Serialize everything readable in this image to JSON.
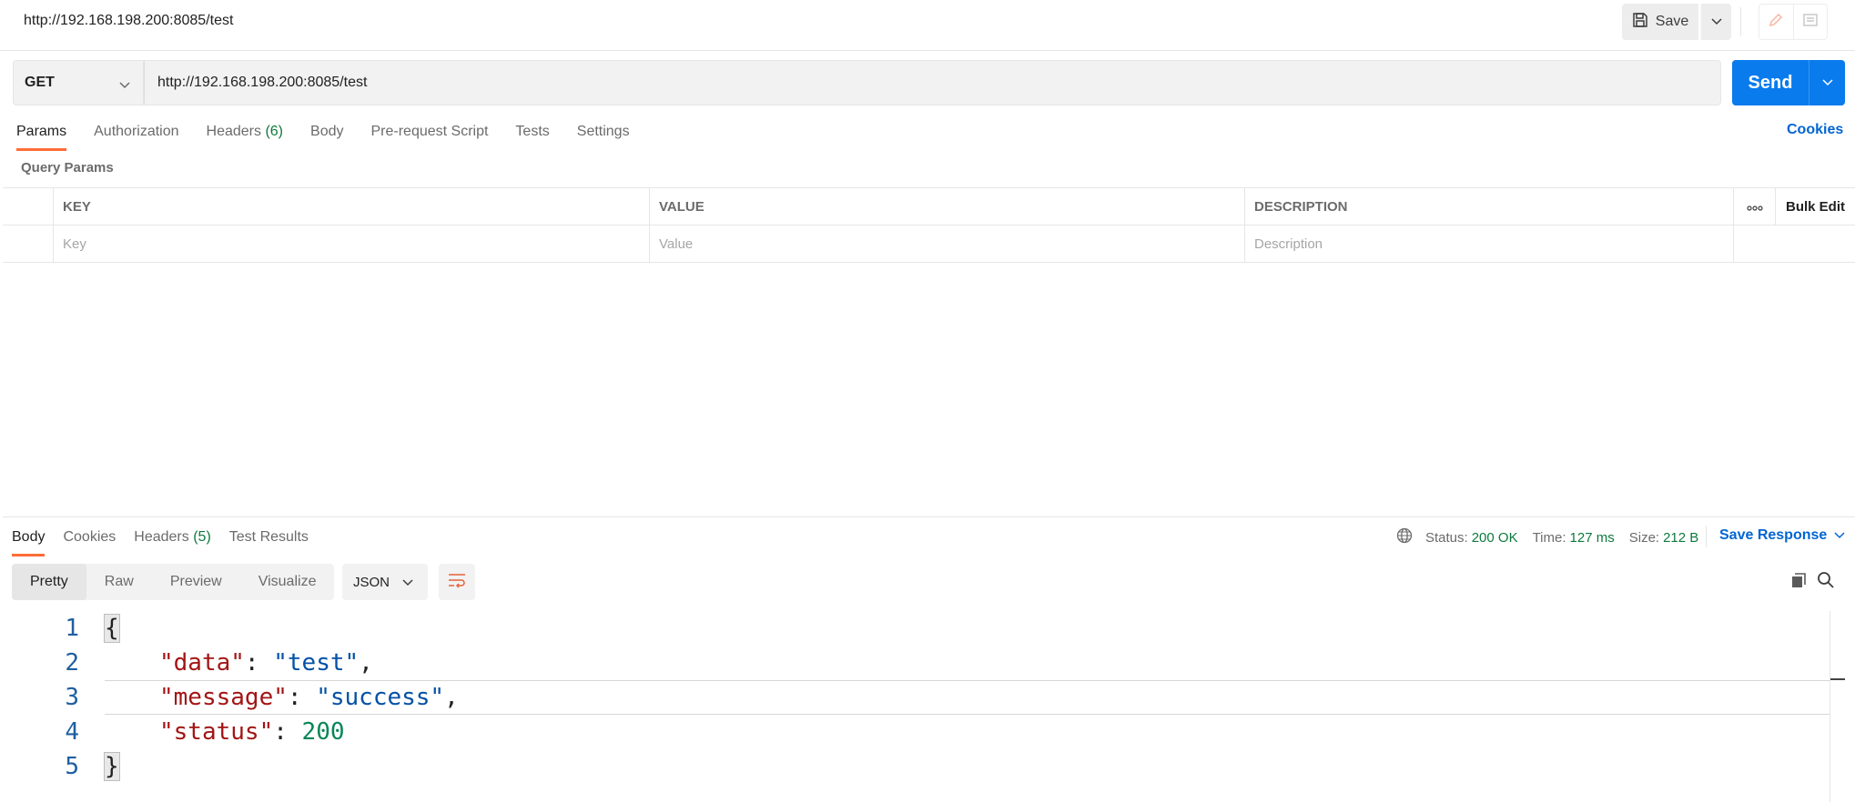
{
  "header": {
    "title": "http://192.168.198.200:8085/test",
    "save_label": "Save"
  },
  "request": {
    "method": "GET",
    "url": "http://192.168.198.200:8085/test",
    "send_label": "Send"
  },
  "request_tabs": [
    {
      "label": "Params",
      "count": "",
      "active": true
    },
    {
      "label": "Authorization",
      "count": ""
    },
    {
      "label": "Headers",
      "count": "(6)"
    },
    {
      "label": "Body",
      "count": ""
    },
    {
      "label": "Pre-request Script",
      "count": ""
    },
    {
      "label": "Tests",
      "count": ""
    },
    {
      "label": "Settings",
      "count": ""
    }
  ],
  "cookies_label": "Cookies",
  "query_params": {
    "title": "Query Params",
    "columns": {
      "key": "KEY",
      "value": "VALUE",
      "description": "DESCRIPTION",
      "bulk_edit": "Bulk Edit"
    },
    "placeholders": {
      "key": "Key",
      "value": "Value",
      "description": "Description"
    }
  },
  "response_tabs": [
    {
      "label": "Body",
      "count": "",
      "active": true
    },
    {
      "label": "Cookies",
      "count": ""
    },
    {
      "label": "Headers",
      "count": "(5)"
    },
    {
      "label": "Test Results",
      "count": ""
    }
  ],
  "response_status": {
    "status_label": "Status:",
    "status_value": "200 OK",
    "time_label": "Time:",
    "time_value": "127 ms",
    "size_label": "Size:",
    "size_value": "212 B",
    "save_response_label": "Save Response"
  },
  "view_modes": [
    "Pretty",
    "Raw",
    "Preview",
    "Visualize"
  ],
  "format": "JSON",
  "code_lines": [
    {
      "num": "1"
    },
    {
      "num": "2",
      "key": "\"data\"",
      "sep": ": ",
      "value": "\"test\"",
      "tail": ","
    },
    {
      "num": "3",
      "key": "\"message\"",
      "sep": ": ",
      "value": "\"success\"",
      "tail": ","
    },
    {
      "num": "4",
      "key": "\"status\"",
      "sep": ": ",
      "value": "200",
      "tail": ""
    },
    {
      "num": "5"
    }
  ],
  "code_braces": {
    "open": "{",
    "close": "}"
  },
  "colors": {
    "accent": "#ff6c37",
    "primary": "#097bed",
    "success": "#0d7a3e",
    "link": "#0265d2"
  }
}
